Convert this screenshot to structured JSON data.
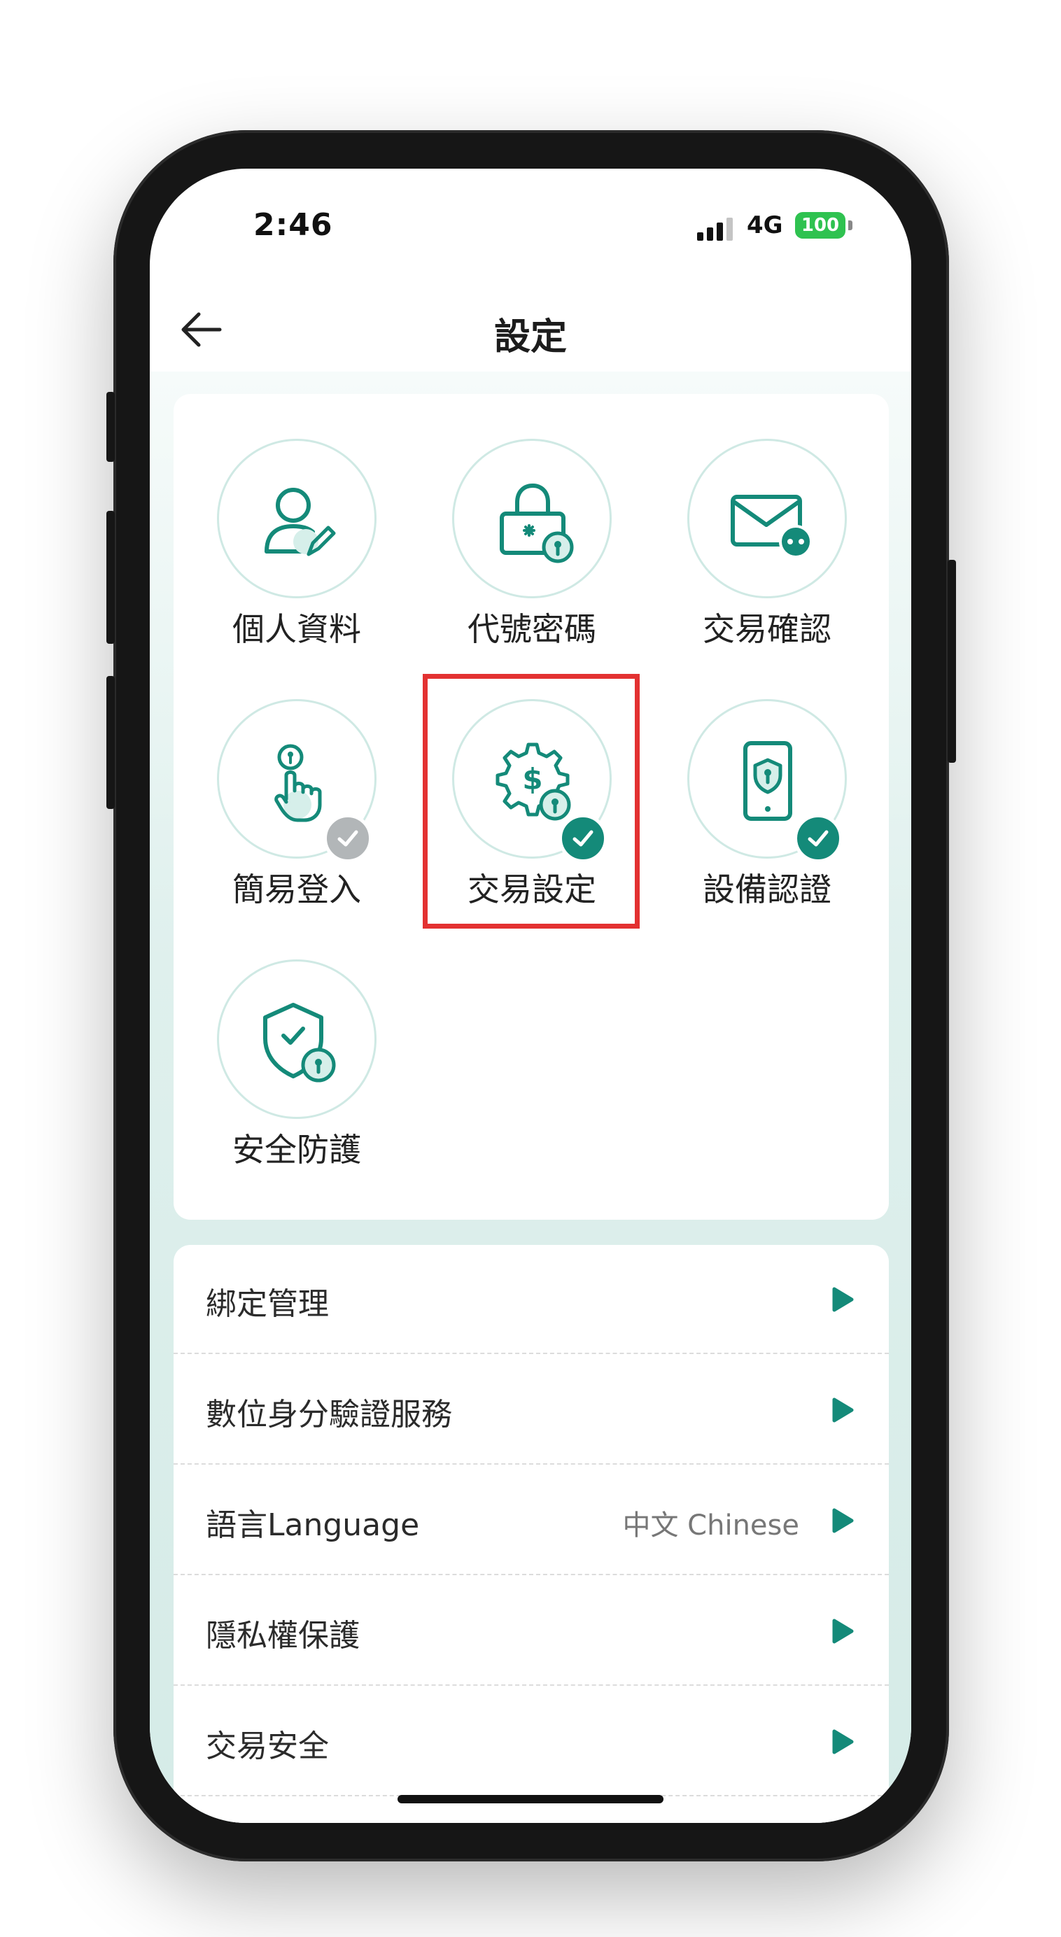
{
  "status_bar": {
    "time": "2:46",
    "network": "4G",
    "battery": "100"
  },
  "header": {
    "title": "設定"
  },
  "grid": {
    "tiles": [
      {
        "label": "個人資料",
        "icon": "profile-edit-icon",
        "badge": "none"
      },
      {
        "label": "代號密碼",
        "icon": "password-lock-icon",
        "badge": "none"
      },
      {
        "label": "交易確認",
        "icon": "mail-confirm-icon",
        "badge": "none"
      },
      {
        "label": "簡易登入",
        "icon": "touch-login-icon",
        "badge": "gray-check"
      },
      {
        "label": "交易設定",
        "icon": "dollar-gear-icon",
        "badge": "green-check",
        "highlighted": true
      },
      {
        "label": "設備認證",
        "icon": "phone-shield-icon",
        "badge": "green-check"
      },
      {
        "label": "安全防護",
        "icon": "shield-lock-icon",
        "badge": "none"
      }
    ]
  },
  "list": {
    "items": [
      {
        "label": "綁定管理",
        "value": ""
      },
      {
        "label": "數位身分驗證服務",
        "value": ""
      },
      {
        "label": "語言Language",
        "value": "中文 Chinese"
      },
      {
        "label": "隱私權保護",
        "value": ""
      },
      {
        "label": "交易安全",
        "value": ""
      }
    ]
  },
  "colors": {
    "accent": "#148a79",
    "circle_border": "#cfe9e4",
    "highlight_box": "#e33131",
    "battery": "#2fc250"
  }
}
